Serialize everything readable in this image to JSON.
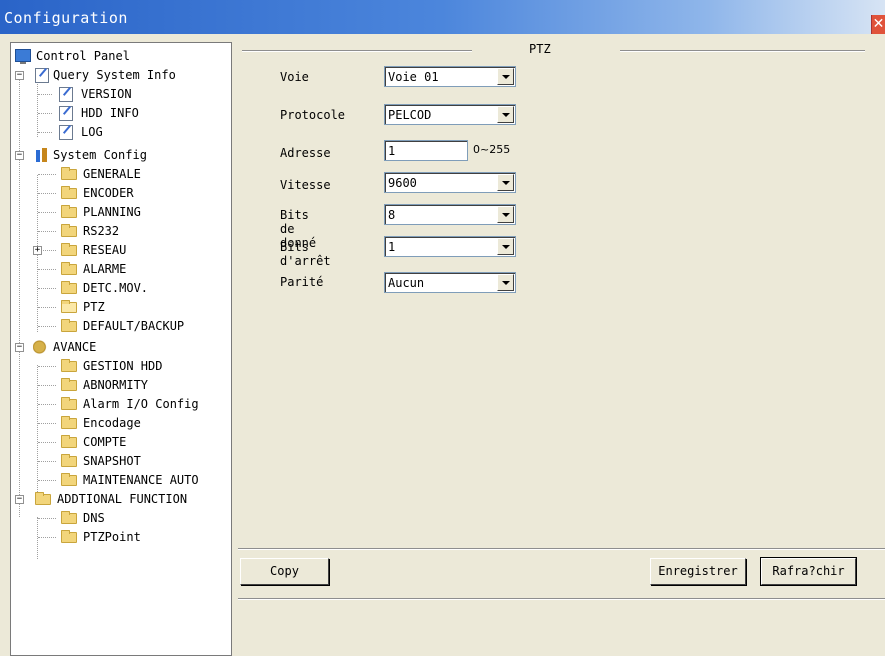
{
  "window": {
    "title": "Configuration",
    "close_glyph": "✕"
  },
  "tree": {
    "root": "Control Panel",
    "query_system_info": {
      "label": "Query System Info",
      "children": [
        "VERSION",
        "HDD INFO",
        "LOG"
      ]
    },
    "system_config": {
      "label": "System Config",
      "children": [
        "GENERALE",
        "ENCODER",
        "PLANNING",
        "RS232",
        "RESEAU",
        "ALARME",
        "DETC.MOV.",
        "PTZ",
        "DEFAULT/BACKUP"
      ]
    },
    "avance": {
      "label": "AVANCE",
      "children": [
        "GESTION HDD",
        "ABNORMITY",
        "Alarm I/O Config",
        "Encodage",
        "COMPTE",
        "SNAPSHOT",
        "MAINTENANCE AUTO"
      ]
    },
    "additional_function": {
      "label": "ADDTIONAL FUNCTION",
      "children": [
        "DNS",
        "PTZPoint"
      ]
    },
    "expander_collapse": "−",
    "expander_expand": "+"
  },
  "ptz": {
    "group_title": "PTZ",
    "voie": {
      "label": "Voie",
      "value": "Voie 01"
    },
    "protocole": {
      "label": "Protocole",
      "value": "PELCOD"
    },
    "adresse": {
      "label": "Adresse",
      "value": "1",
      "range": "0~255"
    },
    "vitesse": {
      "label": "Vitesse",
      "value": "9600"
    },
    "bits_donnees": {
      "label": "Bits de donné",
      "value": "8"
    },
    "bits_arret": {
      "label": "Bits d'arrêt",
      "value": "1"
    },
    "parite": {
      "label": "Parité",
      "value": "Aucun"
    }
  },
  "buttons": {
    "copy": "Copy",
    "save": "Enregistrer",
    "refresh": "Rafra?chir"
  },
  "icons": {
    "folder": "folder-icon",
    "document": "document-icon",
    "monitor": "control-panel-icon",
    "gear": "gear-icon",
    "system": "system-config-icon"
  }
}
